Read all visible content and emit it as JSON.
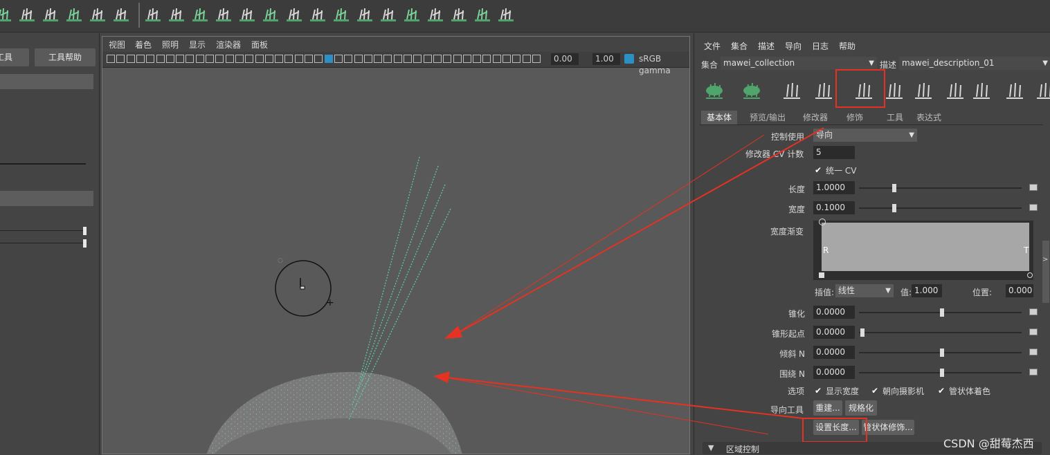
{
  "viewport_menu": [
    "视图",
    "着色",
    "照明",
    "显示",
    "渲染器",
    "面板"
  ],
  "viewport_toolbar": {
    "exposure": "0.00",
    "gamma": "1.00",
    "colorspace": "sRGB gamma"
  },
  "left_panel": {
    "tab_tool": "工具",
    "tab_help": "工具帮助"
  },
  "attr_menu": [
    "文件",
    "集合",
    "描述",
    "导向",
    "日志",
    "帮助"
  ],
  "collection": {
    "label": "集合",
    "value": "mawei_collection"
  },
  "description": {
    "label": "描述",
    "value": "mawei_description_01"
  },
  "tabs": [
    "基本体",
    "预览/输出",
    "修改器",
    "修饰",
    "工具",
    "表达式"
  ],
  "attrs": {
    "control_use": {
      "label": "控制使用",
      "value": "导向"
    },
    "cv_count": {
      "label": "修改器 CV 计数",
      "value": "5"
    },
    "unify_cv": "统一 CV",
    "length": {
      "label": "长度",
      "value": "1.0000",
      "slider_fraction": 0.2
    },
    "width": {
      "label": "宽度",
      "value": "0.1000",
      "slider_fraction": 0.2
    },
    "width_ramp": {
      "label": "宽度渐变",
      "left": "R",
      "right": "T"
    },
    "interp": {
      "label": "插值:",
      "value": "线性"
    },
    "ramp_value": {
      "label": "值:",
      "value": "1.000"
    },
    "ramp_position": {
      "label": "位置:",
      "value": "0.000"
    },
    "taper": {
      "label": "锥化",
      "value": "0.0000",
      "slider_fraction": 0.5
    },
    "taper_start": {
      "label": "锥形起点",
      "value": "0.0000",
      "slider_fraction": 0.0
    },
    "tilt": {
      "label": "倾斜 N",
      "value": "0.0000",
      "slider_fraction": 0.5
    },
    "twist": {
      "label": "围绕 N",
      "value": "0.0000",
      "slider_fraction": 0.5
    },
    "options_label": "选项",
    "options": [
      "显示宽度",
      "朝向摄影机",
      "管状体着色"
    ],
    "guide_tools_label": "导向工具",
    "buttons": [
      "重建...",
      "规格化",
      "设置长度...",
      "管状体修饰..."
    ],
    "section": "区域控制"
  },
  "watermark": "CSDN @甜莓杰西",
  "colors": {
    "accent_red": "#e53222",
    "guide_green": "#5ec9a4",
    "icon_green": "#4fa56b"
  }
}
